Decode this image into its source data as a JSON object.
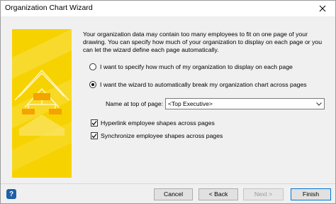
{
  "window": {
    "title": "Organization Chart Wizard"
  },
  "description": "Your organization data may contain too many employees to fit on one page of your drawing. You can specify how much of your organization to display on each page or you can let the wizard define each page automatically.",
  "options": {
    "specify_label": "I want to specify how much of my organization to display on each page",
    "auto_label": "I want the wizard to automatically break my organization chart across pages",
    "selected": "auto"
  },
  "name_at_top": {
    "label": "Name at top of page:",
    "value": "<Top Executive>"
  },
  "checkboxes": {
    "hyperlink": {
      "label": "Hyperlink employee shapes across pages",
      "checked": true
    },
    "synchronize": {
      "label": "Synchronize employee shapes across pages",
      "checked": true
    }
  },
  "buttons": {
    "cancel": "Cancel",
    "back": "< Back",
    "next": "Next >",
    "finish": "Finish"
  },
  "help_icon_text": "?",
  "colors": {
    "banner": "#f6d200",
    "accent": "#0078d7"
  }
}
